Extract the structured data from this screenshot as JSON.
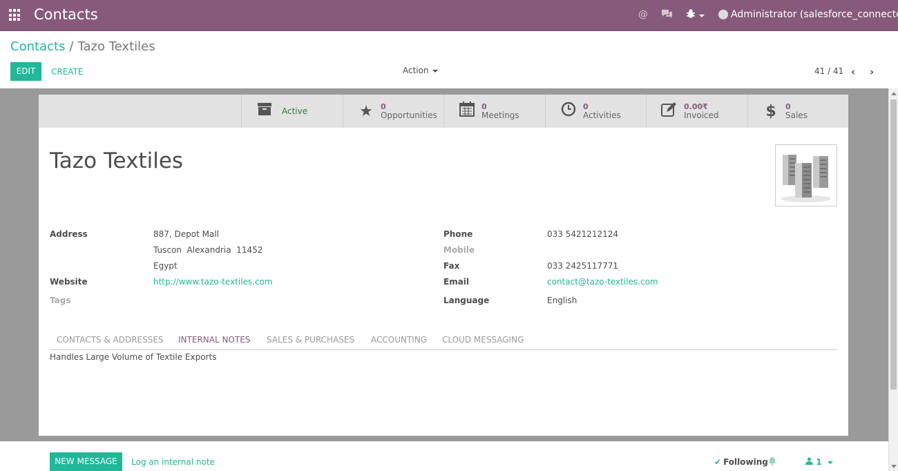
{
  "topbar": {
    "app_title": "Contacts",
    "user_label": "Administrator (salesforce_connector)",
    "icons": [
      "apps-icon",
      "mention-icon",
      "chat-icon",
      "bug-icon"
    ]
  },
  "breadcrumb": {
    "parent": "Contacts",
    "separator": "/",
    "current": "Tazo Textiles"
  },
  "buttons": {
    "edit": "EDIT",
    "create": "CREATE",
    "action": "Action"
  },
  "pager": {
    "value": "41 / 41"
  },
  "smart_buttons": {
    "active": {
      "label": "Active"
    },
    "opportunities": {
      "count": "0",
      "label": "Opportunities"
    },
    "meetings": {
      "count": "0",
      "label": "Meetings"
    },
    "activities": {
      "count": "0",
      "label": "Activities"
    },
    "invoiced": {
      "count": "0.00₹",
      "label": "Invoiced"
    },
    "sales": {
      "count": "0",
      "label": "Sales"
    }
  },
  "partner": {
    "name": "Tazo Textiles",
    "labels": {
      "address": "Address",
      "website": "Website",
      "tags": "Tags",
      "phone": "Phone",
      "mobile": "Mobile",
      "fax": "Fax",
      "email": "Email",
      "language": "Language"
    },
    "address_line1": "887, Depot Mall",
    "address_line2": "Tuscon  Alexandria  11452",
    "address_line3": "Egypt",
    "website": "http://www.tazo-textiles.com",
    "phone": "033 5421212124",
    "fax": "033 2425117771",
    "email": "contact@tazo-textiles.com",
    "language": "English"
  },
  "tabs": [
    "CONTACTS & ADDRESSES",
    "INTERNAL NOTES",
    "SALES & PURCHASES",
    "ACCOUNTING",
    "CLOUD MESSAGING"
  ],
  "active_tab": "INTERNAL NOTES",
  "internal_notes": "Handles Large Volume of Textile Exports",
  "chatter": {
    "new_message": "NEW MESSAGE",
    "log_note": "Log an internal note",
    "following": "Following",
    "followers_count": "1"
  },
  "colors": {
    "brand": "#875a7b",
    "accent": "#21b799"
  }
}
